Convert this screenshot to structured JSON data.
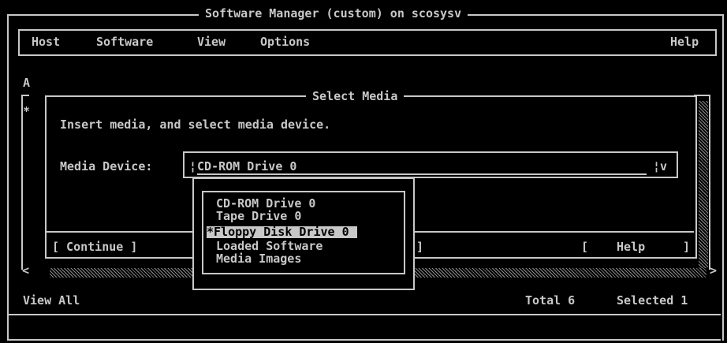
{
  "window": {
    "title": "Software Manager (custom) on scosysv"
  },
  "menubar": {
    "items": [
      "Host",
      "Software",
      "View",
      "Options"
    ],
    "help": "Help"
  },
  "list": {
    "col_label": "A",
    "row_marker": "*",
    "left_arrow": "<",
    "right_arrow": ">"
  },
  "dialog": {
    "title": "Select Media",
    "instruction": "Insert media, and select media device.",
    "field_label": "Media Device:",
    "field_left_bracket": "¦",
    "field_value": "CD-ROM Drive 0",
    "field_right": "¦v",
    "continue_button": "[ Continue ]",
    "hidden_button_edge": "]",
    "help_open": "[",
    "help_label": "Help",
    "help_close": "]"
  },
  "dropdown": {
    "options": [
      "CD-ROM Drive 0",
      "Tape Drive 0",
      "Floppy Disk Drive 0",
      "Loaded Software",
      "Media Images"
    ],
    "focused_prefix": "*",
    "focused_index": 2
  },
  "statusbar": {
    "view": "View All",
    "total": "Total 6",
    "selected": "Selected 1"
  }
}
